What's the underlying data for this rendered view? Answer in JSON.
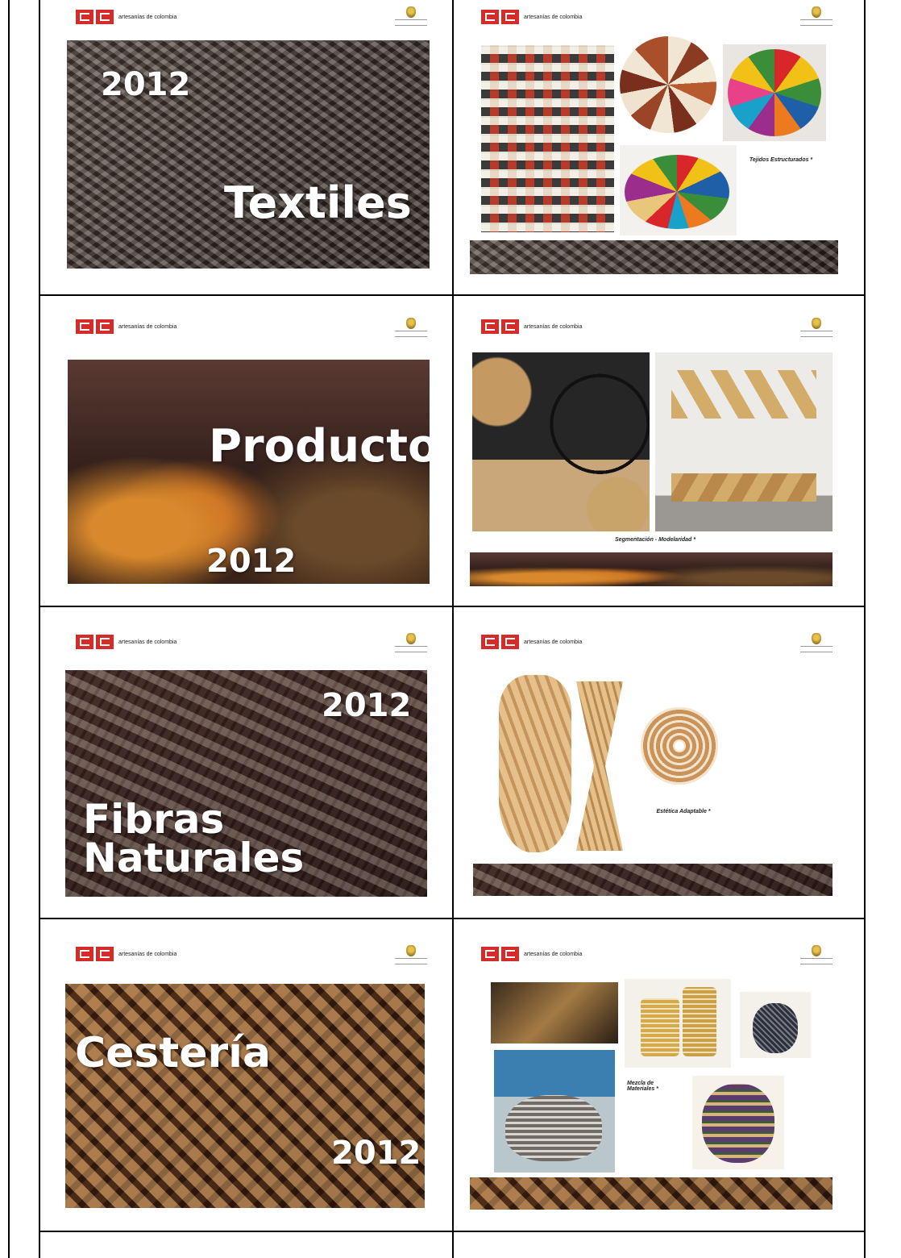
{
  "brand_text": "artesanías de colombia",
  "slides": [
    {
      "id": "textiles",
      "title": "Textiles",
      "year": "2012"
    },
    {
      "id": "tejidos",
      "caption": "Tejidos Estructurados *"
    },
    {
      "id": "producto",
      "title": "Producto",
      "year": "2012"
    },
    {
      "id": "segmentacion",
      "caption": "Segmentación - Modelaridad *"
    },
    {
      "id": "fibras",
      "title_line1": "Fibras",
      "title_line2": "Naturales",
      "year": "2012"
    },
    {
      "id": "estetica",
      "caption": "Estética Adaptable *"
    },
    {
      "id": "cesteria",
      "title": "Cestería",
      "year": "2012"
    },
    {
      "id": "mezcla",
      "caption": "Mezcla de Materiales *"
    }
  ],
  "colors": {
    "logo_red": "#d62b28",
    "rule": "#000000"
  }
}
